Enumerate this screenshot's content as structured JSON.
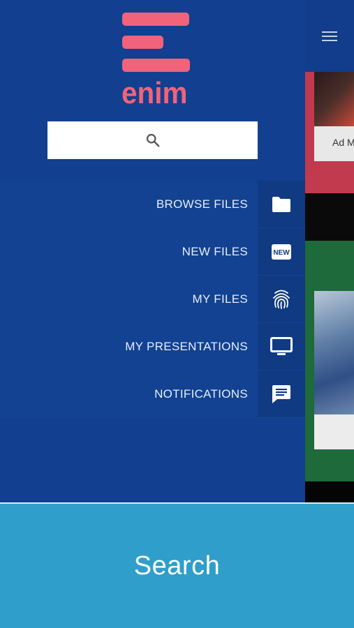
{
  "logo": {
    "text": "enim",
    "color": "#f0637a"
  },
  "search": {
    "placeholder": ""
  },
  "menu": {
    "items": [
      {
        "label": "BROWSE FILES",
        "icon": "folder-icon"
      },
      {
        "label": "NEW FILES",
        "icon": "new-badge-icon"
      },
      {
        "label": "MY FILES",
        "icon": "fingerprint-icon"
      },
      {
        "label": "MY PRESENTATIONS",
        "icon": "monitor-icon"
      },
      {
        "label": "NOTIFICATIONS",
        "icon": "message-icon"
      }
    ]
  },
  "background": {
    "card_caption": "Ad M"
  },
  "bottom_bar": {
    "label": "Search"
  },
  "colors": {
    "drawer": "#123f8f",
    "accent": "#f0637a",
    "bottom": "#2f9ecb"
  }
}
